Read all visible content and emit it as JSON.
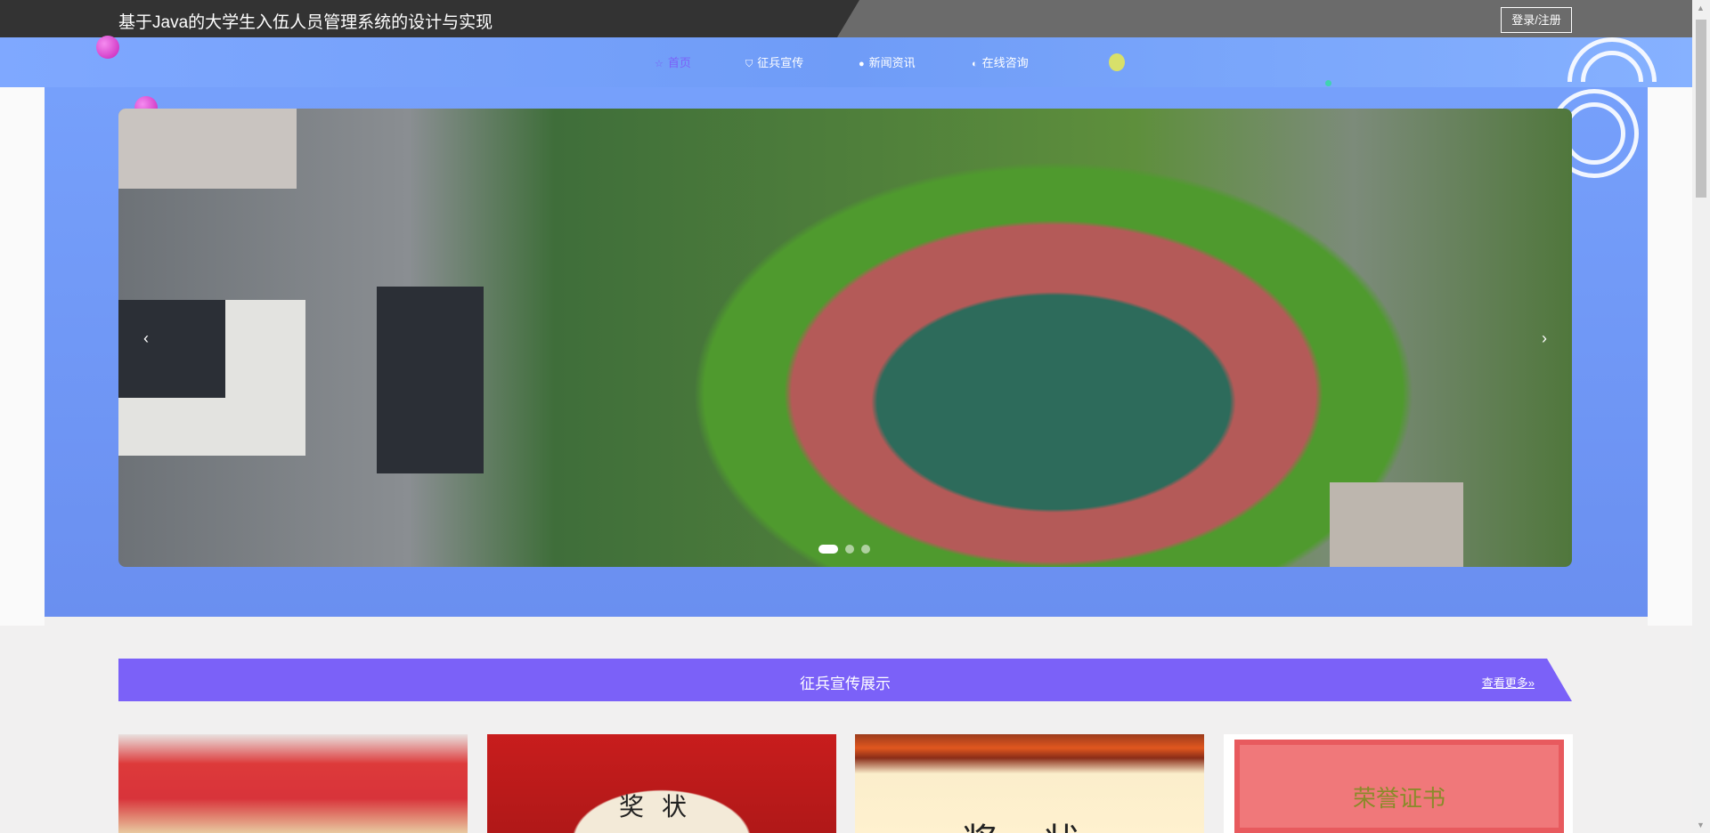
{
  "header": {
    "title": "基于Java的大学生入伍人员管理系统的设计与实现",
    "login_label": "登录/注册"
  },
  "nav": {
    "items": [
      {
        "label": "首页",
        "icon": "star-icon",
        "glyph": "☆",
        "active": true
      },
      {
        "label": "征兵宣传",
        "icon": "bag-icon",
        "glyph": "⛉",
        "active": false
      },
      {
        "label": "新闻资讯",
        "icon": "info-icon",
        "glyph": "●",
        "active": false
      },
      {
        "label": "在线咨询",
        "icon": "headset-icon",
        "glyph": "◐",
        "active": false
      }
    ]
  },
  "carousel": {
    "prev": "‹",
    "next": "›",
    "slides": 3,
    "current": 1
  },
  "section": {
    "title": "征兵宣传展示",
    "more_label": "查看更多»"
  },
  "cards": [
    {
      "text": "奖状"
    },
    {
      "text": "奖 状"
    },
    {
      "text": "荣誉证书"
    }
  ],
  "colors": {
    "accent": "#7b61f8",
    "header_dark": "#333333",
    "header_grey": "#6b6b6b",
    "band": "#76a0fb"
  }
}
